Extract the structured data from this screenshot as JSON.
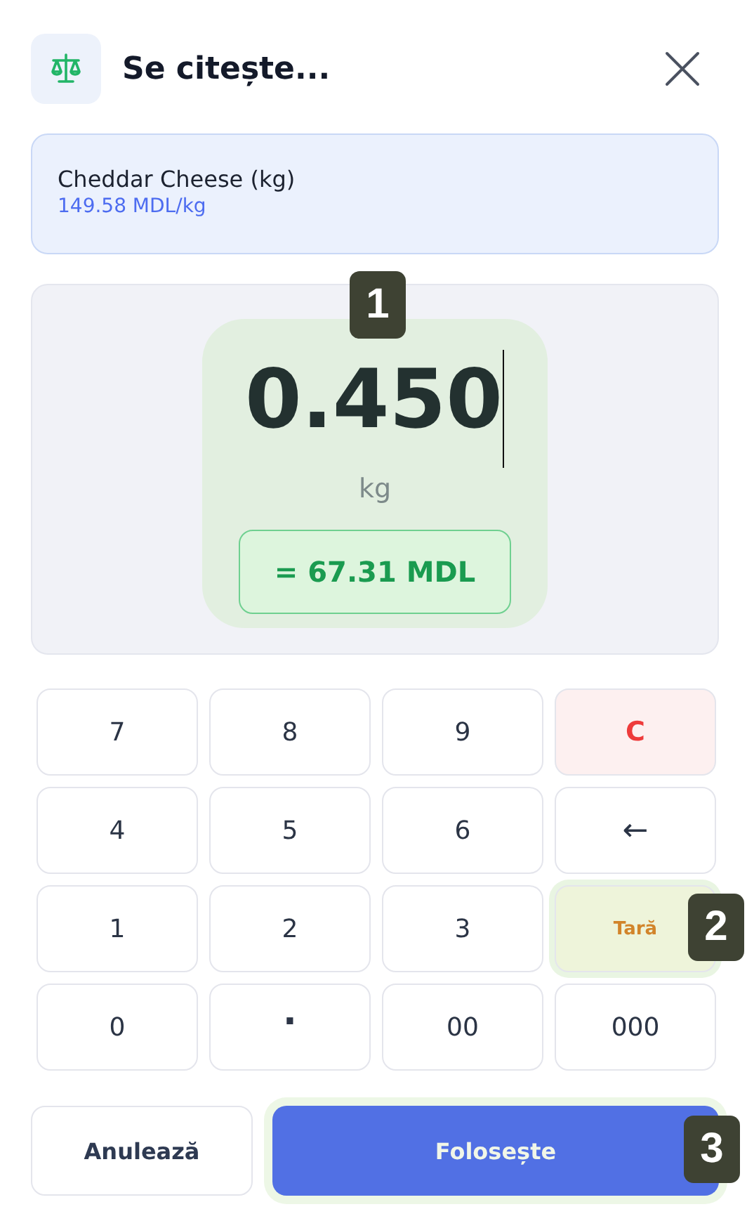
{
  "header": {
    "title": "Se citește..."
  },
  "product": {
    "name": "Cheddar Cheese (kg)",
    "price": "149.58 MDL/kg"
  },
  "display": {
    "value": "0.450",
    "unit": "kg",
    "total": "= 67.31 MDL",
    "marker": "1"
  },
  "keys": [
    {
      "label": "7",
      "kind": "digit"
    },
    {
      "label": "8",
      "kind": "digit"
    },
    {
      "label": "9",
      "kind": "digit"
    },
    {
      "label": "C",
      "kind": "clear"
    },
    {
      "label": "4",
      "kind": "digit"
    },
    {
      "label": "5",
      "kind": "digit"
    },
    {
      "label": "6",
      "kind": "digit"
    },
    {
      "label": "←",
      "kind": "back"
    },
    {
      "label": "1",
      "kind": "digit"
    },
    {
      "label": "2",
      "kind": "digit"
    },
    {
      "label": "3",
      "kind": "digit"
    },
    {
      "label": "Tară",
      "kind": "tare",
      "marker": "2"
    },
    {
      "label": "0",
      "kind": "digit"
    },
    {
      "label": ".",
      "kind": "dot"
    },
    {
      "label": "00",
      "kind": "digit"
    },
    {
      "label": "000",
      "kind": "digit"
    }
  ],
  "buttons": [
    {
      "label": "Anulează",
      "kind": "secondary"
    },
    {
      "label": "Folosește",
      "kind": "primary",
      "marker": "3"
    }
  ]
}
